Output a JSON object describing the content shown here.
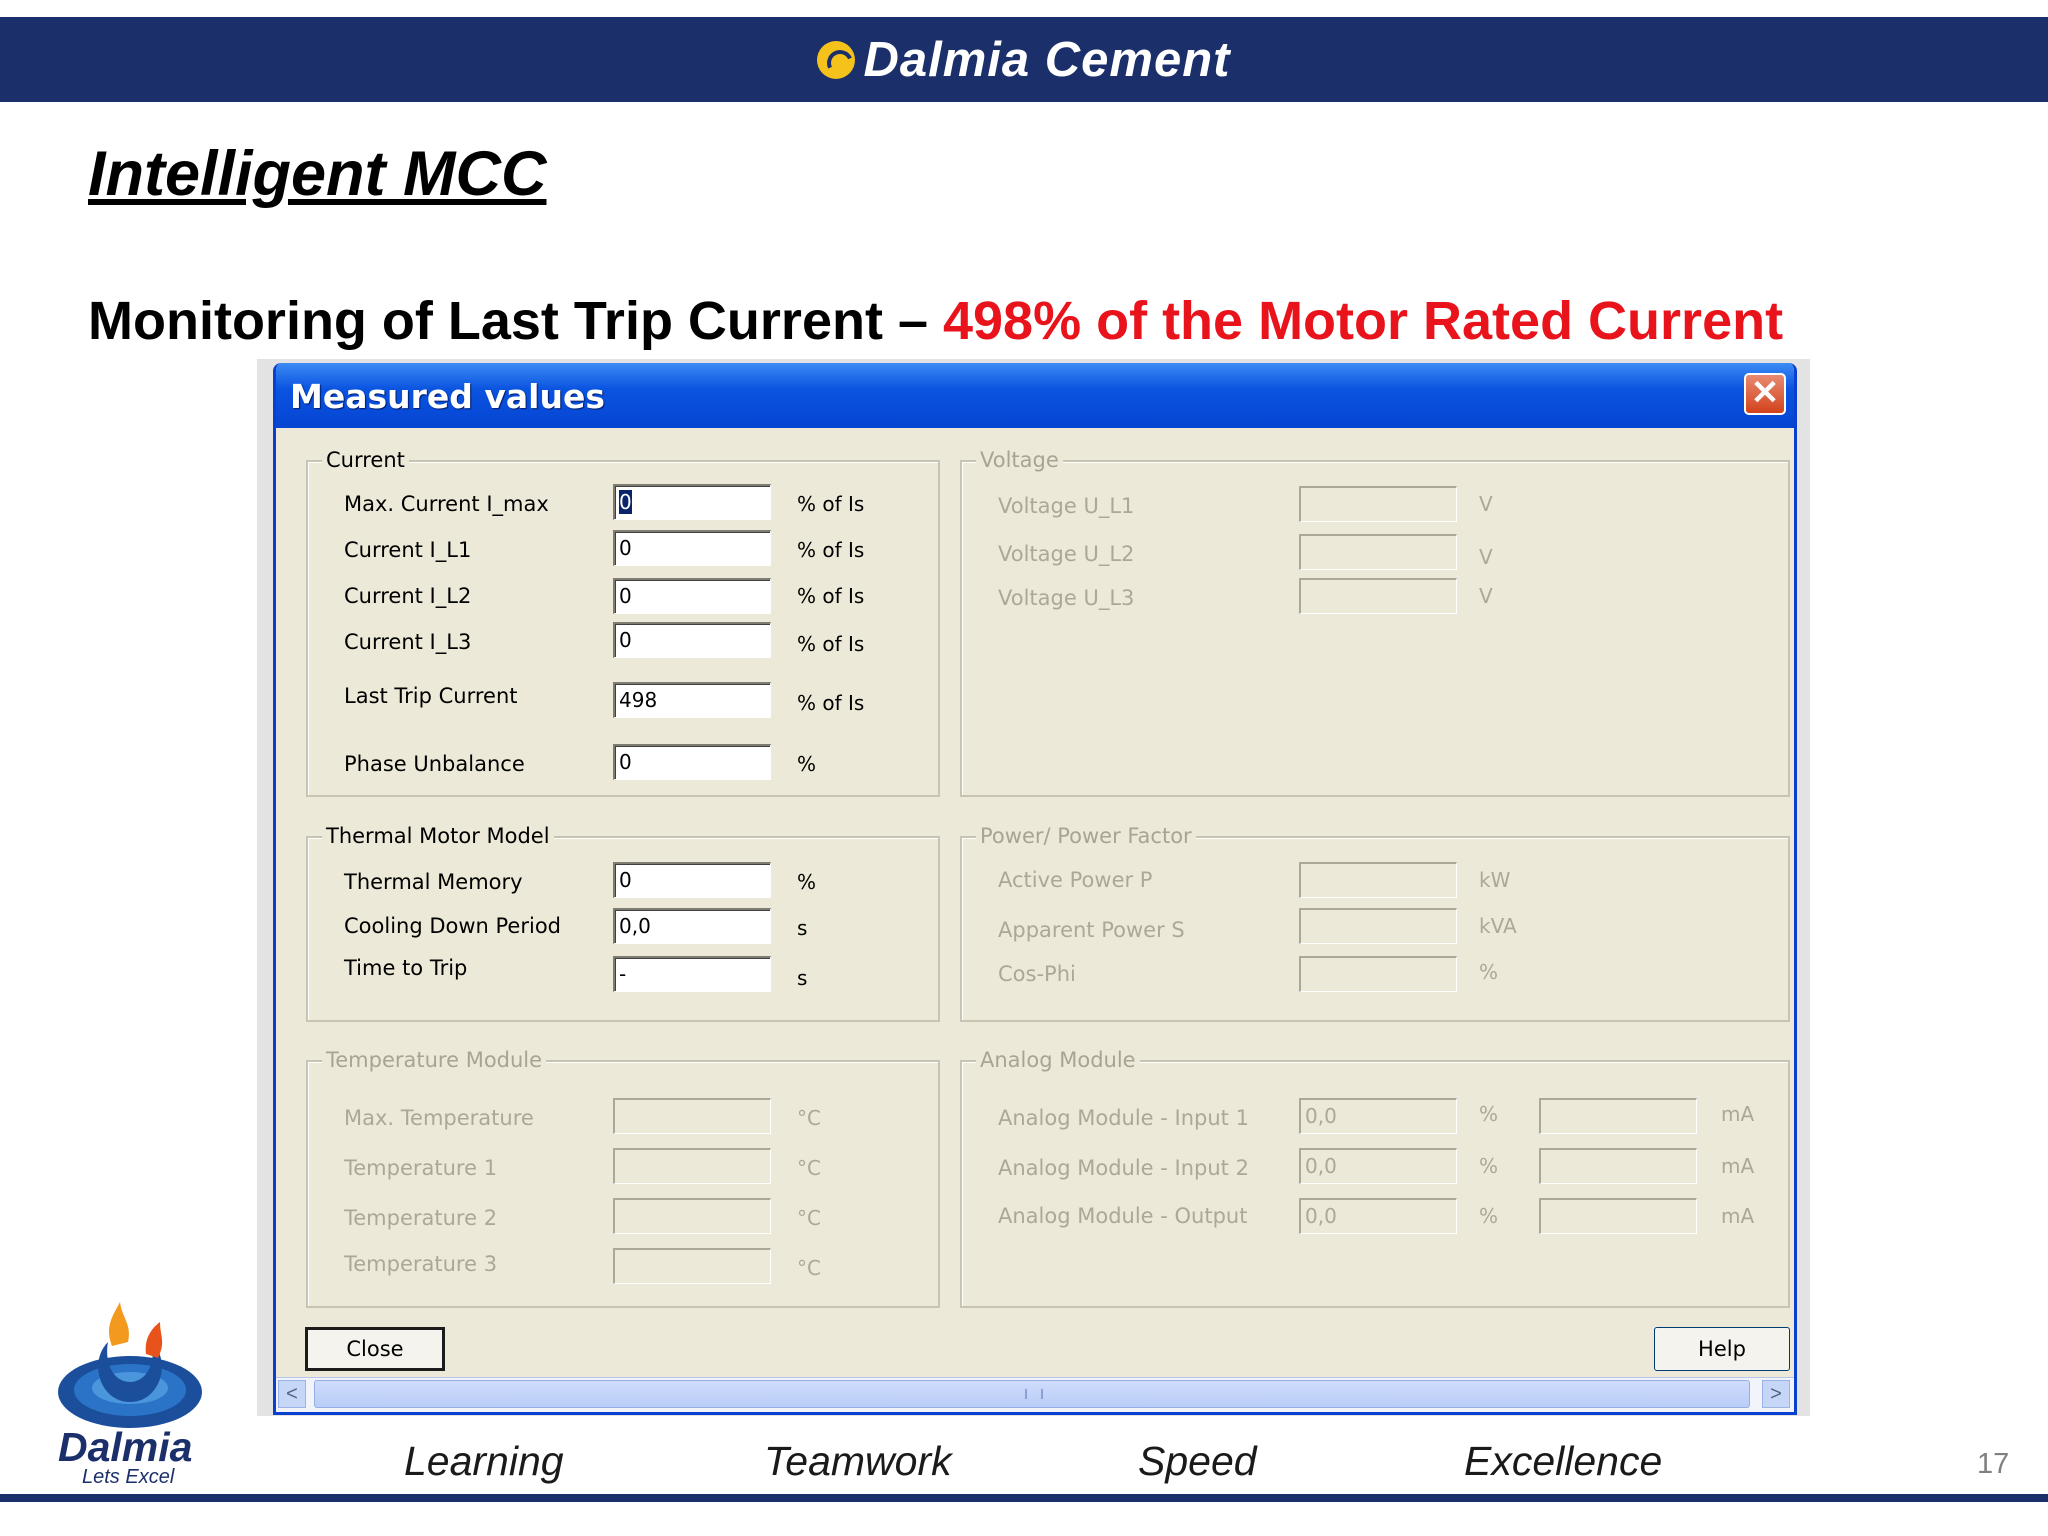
{
  "header": {
    "brand": "Dalmia Cement"
  },
  "slide": {
    "title": "Intelligent MCC",
    "subtitle_prefix": "Monitoring of Last Trip Current – ",
    "subtitle_highlight": "498% of the Motor Rated Current",
    "page_number": "17"
  },
  "dialog": {
    "title": "Measured values",
    "close_glyph": "✕",
    "current": {
      "legend": "Current",
      "rows": [
        {
          "label": "Max. Current I_max",
          "value": "0",
          "unit": "% of Is"
        },
        {
          "label": "Current I_L1",
          "value": "0",
          "unit": "% of Is"
        },
        {
          "label": "Current I_L2",
          "value": "0",
          "unit": "% of Is"
        },
        {
          "label": "Current I_L3",
          "value": "0",
          "unit": "% of Is"
        },
        {
          "label": "Last Trip Current",
          "value": "498",
          "unit": "% of Is"
        },
        {
          "label": "Phase Unbalance",
          "value": "0",
          "unit": "%"
        }
      ]
    },
    "voltage": {
      "legend": "Voltage",
      "rows": [
        {
          "label": "Voltage U_L1",
          "value": "",
          "unit": "V"
        },
        {
          "label": "Voltage U_L2",
          "value": "",
          "unit": "V"
        },
        {
          "label": "Voltage U_L3",
          "value": "",
          "unit": "V"
        }
      ]
    },
    "thermal": {
      "legend": "Thermal Motor Model",
      "rows": [
        {
          "label": "Thermal Memory",
          "value": "0",
          "unit": "%"
        },
        {
          "label": "Cooling Down Period",
          "value": "0,0",
          "unit": "s"
        },
        {
          "label": "Time to Trip",
          "value": "-",
          "unit": "s"
        }
      ]
    },
    "power": {
      "legend": "Power/ Power Factor",
      "rows": [
        {
          "label": "Active Power P",
          "value": "",
          "unit": "kW"
        },
        {
          "label": "Apparent Power S",
          "value": "",
          "unit": "kVA"
        },
        {
          "label": "Cos-Phi",
          "value": "",
          "unit": "%"
        }
      ]
    },
    "temperature": {
      "legend": "Temperature Module",
      "rows": [
        {
          "label": "Max. Temperature",
          "value": "",
          "unit": "°C"
        },
        {
          "label": "Temperature 1",
          "value": "",
          "unit": "°C"
        },
        {
          "label": "Temperature 2",
          "value": "",
          "unit": "°C"
        },
        {
          "label": "Temperature 3",
          "value": "",
          "unit": "°C"
        }
      ]
    },
    "analog": {
      "legend": "Analog Module",
      "rows": [
        {
          "label": "Analog Module - Input 1",
          "value": "0,0",
          "unit": "%",
          "ma_value": "",
          "ma_unit": "mA"
        },
        {
          "label": "Analog Module - Input 2",
          "value": "0,0",
          "unit": "%",
          "ma_value": "",
          "ma_unit": "mA"
        },
        {
          "label": "Analog Module - Output",
          "value": "0,0",
          "unit": "%",
          "ma_value": "",
          "ma_unit": "mA"
        }
      ]
    },
    "buttons": {
      "close": "Close",
      "help": "Help"
    },
    "scrollbar": {
      "left_arrow": "<",
      "right_arrow": ">"
    }
  },
  "logo": {
    "word": "Dalmia",
    "tagline": "Lets Excel"
  },
  "values": [
    "Learning",
    "Teamwork",
    "Speed",
    "Excellence"
  ],
  "colors": {
    "banner": "#1b2f6b",
    "highlight": "#e8131b",
    "dialog_face": "#ece9d8",
    "titlebar": "#0a54e0"
  }
}
